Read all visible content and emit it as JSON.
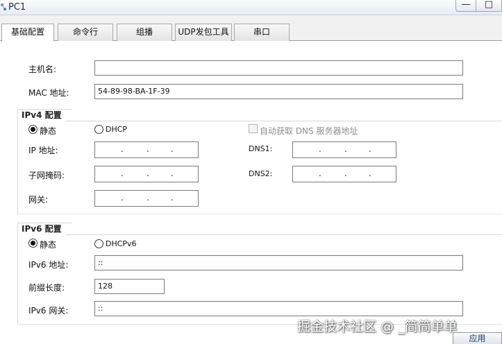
{
  "window": {
    "title": "PC1",
    "minimize_glyph": "—",
    "maximize_glyph": "□"
  },
  "tabs": [
    {
      "label": "基础配置",
      "active": true
    },
    {
      "label": "命令行"
    },
    {
      "label": "组播"
    },
    {
      "label": "UDP发包工具"
    },
    {
      "label": "串口"
    }
  ],
  "basic": {
    "hostname_label": "主机名:",
    "hostname_value": "",
    "mac_label": "MAC 地址:",
    "mac_value": "54-89-98-BA-1F-39"
  },
  "ipv4": {
    "section_title": "IPv4 配置",
    "static_label": "静态",
    "dhcp_label": "DHCP",
    "auto_dns_label": "自动获取 DNS 服务器地址",
    "ip_label": "IP 地址:",
    "mask_label": "子网掩码:",
    "gateway_label": "网关:",
    "dns1_label": "DNS1:",
    "dns2_label": "DNS2:",
    "mode": "static"
  },
  "ipv6": {
    "section_title": "IPv6 配置",
    "static_label": "静态",
    "dhcpv6_label": "DHCPv6",
    "address_label": "IPv6 地址:",
    "address_value": "::",
    "prefix_label": "前缀长度:",
    "prefix_value": "128",
    "gateway_label": "IPv6 网关:",
    "gateway_value": "::",
    "mode": "static"
  },
  "footer": {
    "apply_label": "应用"
  },
  "watermark": "掘金技术社区 @ _简简单单_",
  "icons": {
    "app": "network-pc-icon"
  },
  "colors": {
    "titlebar": "#e6ecf4",
    "tabbar": "#f1f1f1",
    "title_text": "#1c2c44"
  }
}
